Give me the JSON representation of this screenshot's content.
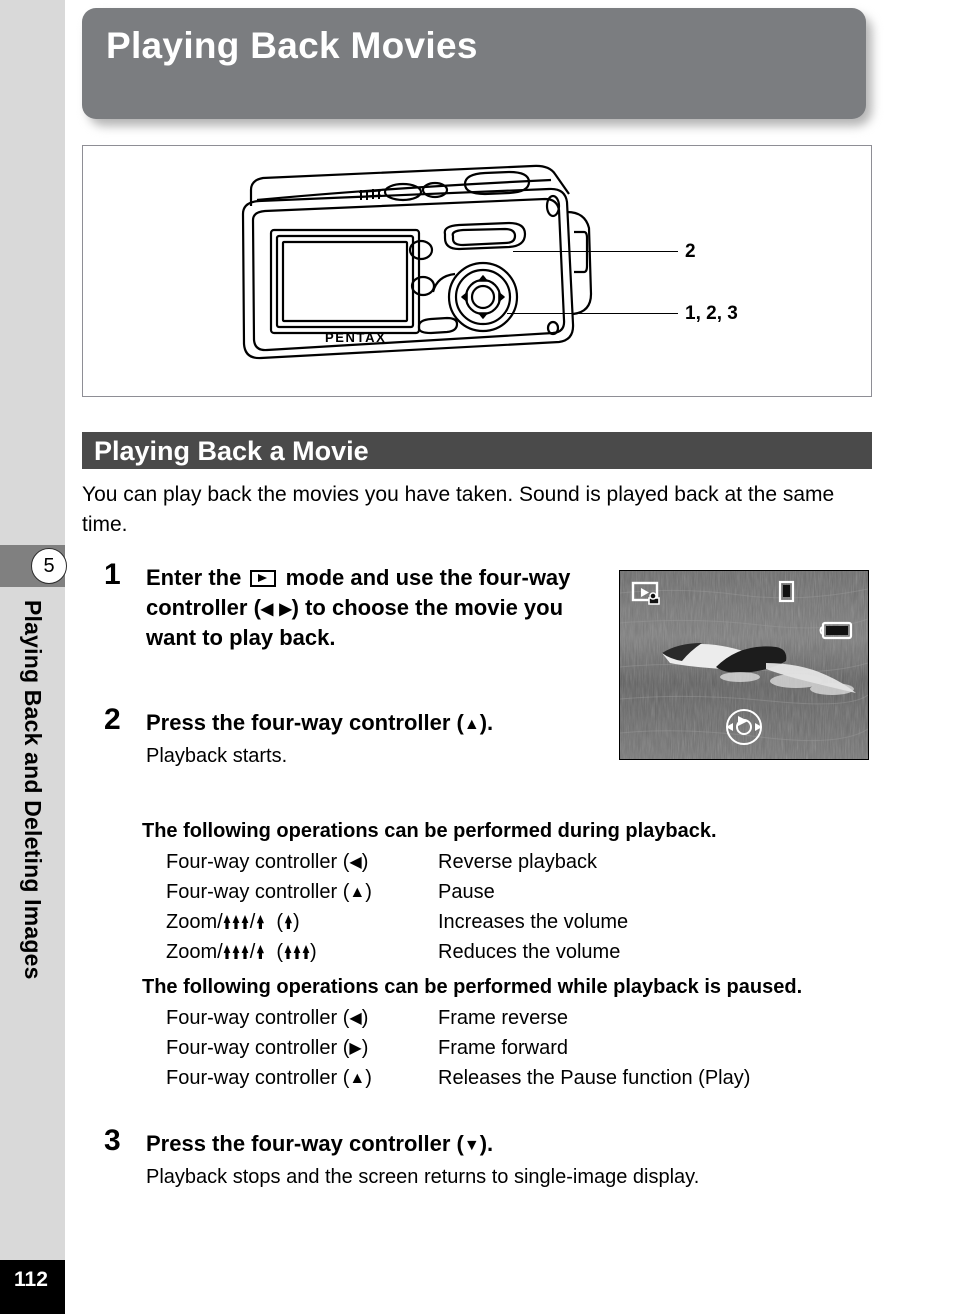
{
  "sidebar": {
    "chapter_number": "5",
    "chapter_title": "Playing Back and Deleting Images",
    "page_number": "112"
  },
  "banner": {
    "title": "Playing Back Movies",
    "bg_color": "#7b7d80"
  },
  "diagram": {
    "name": "camera-rear-view",
    "brand_text": "PENTAX",
    "callouts": [
      {
        "label": "2",
        "target": "zoom-lever"
      },
      {
        "label": "1, 2, 3",
        "target": "four-way-controller"
      }
    ]
  },
  "section": {
    "heading": "Playing Back a Movie",
    "heading_bg": "#4a4a4a",
    "intro": "You can play back the movies you have taken. Sound is played back at the same time."
  },
  "steps": [
    {
      "number": "1",
      "title_parts": [
        "Enter the ",
        " mode and use the four-way controller (",
        ") to choose the movie you want to play back."
      ],
      "title_plain": "Enter the [playback] mode and use the four-way controller (◀▶) to choose the movie you want to play back.",
      "sub": ""
    },
    {
      "number": "2",
      "title_plain": "Press the four-way controller (▲).",
      "sub": "Playback starts."
    },
    {
      "number": "3",
      "title_plain": "Press the four-way controller (▼).",
      "sub": "Playback stops and the screen returns to single-image display."
    }
  ],
  "lcd_preview": {
    "alt": "dolphin swimming, movie playback screen",
    "icons": [
      "movie-playback-icon",
      "memory-card-icon",
      "battery-icon",
      "four-way-controller-guide-icon"
    ]
  },
  "operations_during": {
    "heading": "The following operations can be performed during playback.",
    "rows": [
      {
        "key": "Four-way controller (◀)",
        "value": "Reverse playback"
      },
      {
        "key": "Four-way controller (▲)",
        "value": "Pause"
      },
      {
        "key": "Zoom/w/x  (x)",
        "value": "Increases the volume"
      },
      {
        "key": "Zoom/w/x  (w)",
        "value": "Reduces the volume"
      }
    ]
  },
  "operations_paused": {
    "heading": "The following operations can be performed while playback is paused.",
    "rows": [
      {
        "key": "Four-way controller (◀)",
        "value": "Frame reverse"
      },
      {
        "key": "Four-way controller (▶)",
        "value": "Frame forward"
      },
      {
        "key": "Four-way controller (▲)",
        "value": "Releases the Pause function (Play)"
      }
    ]
  }
}
